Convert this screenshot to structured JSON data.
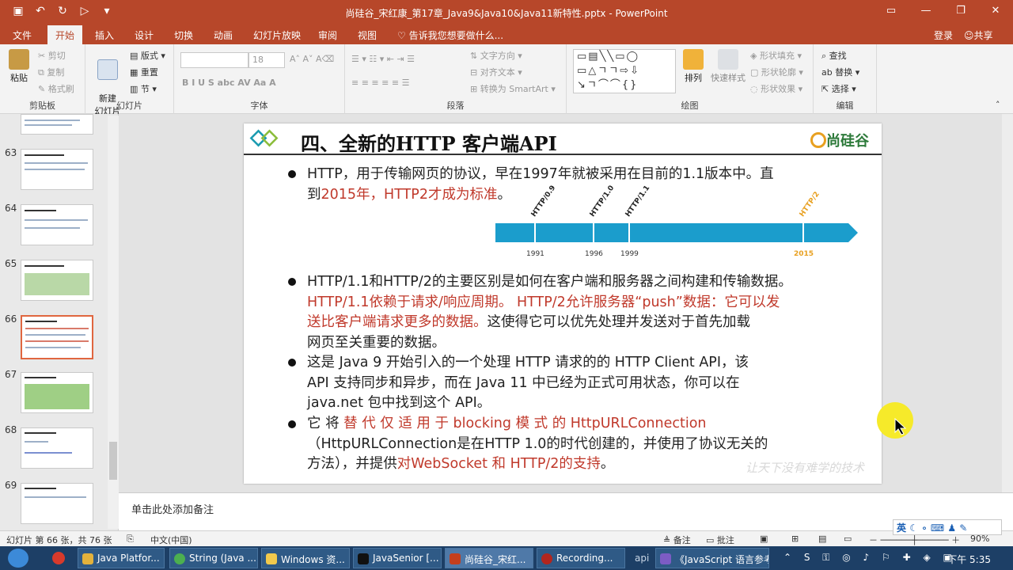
{
  "window": {
    "title": "尚硅谷_宋红康_第17章_Java9&Java10&Java11新特性.pptx - PowerPoint"
  },
  "ribbon_tabs": [
    "文件",
    "开始",
    "插入",
    "设计",
    "切换",
    "动画",
    "幻灯片放映",
    "审阅",
    "视图",
    "告诉我您想要做什么..."
  ],
  "account": {
    "login": "登录",
    "share": "共享"
  },
  "ribbon": {
    "clipboard": {
      "paste": "粘贴",
      "cut": "剪切",
      "copy": "复制",
      "format_painter": "格式刷",
      "label": "剪贴板"
    },
    "slides": {
      "new_slide": "新建\n幻灯片",
      "layout": "版式",
      "reset": "重置",
      "section": "节",
      "label": "幻灯片"
    },
    "font": {
      "size": "18",
      "label": "字体"
    },
    "paragraph": {
      "text_direction": "文字方向",
      "align_text": "对齐文本",
      "smartart": "转换为 SmartArt",
      "label": "段落"
    },
    "drawing": {
      "arrange": "排列",
      "quick_styles": "快速样式",
      "shape_fill": "形状填充",
      "shape_outline": "形状轮廓",
      "shape_effects": "形状效果",
      "label": "绘图"
    },
    "editing": {
      "find": "查找",
      "replace": "替换",
      "select": "选择",
      "label": "编辑"
    }
  },
  "thumbnails": [
    {
      "num": "63"
    },
    {
      "num": "64"
    },
    {
      "num": "65"
    },
    {
      "num": "66"
    },
    {
      "num": "67"
    },
    {
      "num": "68"
    },
    {
      "num": "69"
    }
  ],
  "slide": {
    "title": "四、全新的HTTP 客户端API",
    "logo": "尚硅谷",
    "b1_line1": "HTTP，用于传输网页的协议，早在1997年就被采用在目前的1.1版本中。直",
    "b1_line2a": "到",
    "b1_line2b": "2015年，HTTP2才成为标准",
    "b1_line2c": "。",
    "timeline": {
      "versions": [
        "HTTP/0.9",
        "HTTP/1.0",
        "HTTP/1.1",
        "HTTP/2"
      ],
      "years": [
        "1991",
        "1996",
        "1999",
        "2015"
      ]
    },
    "b2_line1": "HTTP/1.1和HTTP/2的主要区别是如何在客户端和服务器之间构建和传输数据。",
    "b2_line2": "HTTP/1.1依赖于请求/响应周期。 HTTP/2允许服务器“push”数据：它可以发",
    "b2_line3a": "送比客户端请求更多的数据。",
    "b2_line3b": "这使得它可以优先处理并发送对于首先加载",
    "b2_line4": "网页至关重要的数据。",
    "b3_line1": "这是 Java 9 开始引入的一个处理 HTTP 请求的的 HTTP Client API，该",
    "b3_line2": "API 支持同步和异步，而在 Java 11 中已经为正式可用状态，你可以在",
    "b3_line3": "java.net 包中找到这个 API。",
    "b4_line1a": "它 将 ",
    "b4_line1b": "替 代 仅 适 用 于 blocking 模 式 的 HttpURLConnection",
    "b4_line2": "（HttpURLConnection是在HTTP 1.0的时代创建的，并使用了协议无关的",
    "b4_line3a": "方法），并提供",
    "b4_line3b": "对WebSocket 和 HTTP/2的支持",
    "b4_line3c": "。",
    "watermark": "让天下没有难学的技术"
  },
  "notes": {
    "placeholder": "单击此处添加备注"
  },
  "status": {
    "slide_count": "幻灯片 第 66 张，共 76 张",
    "language": "中文(中国)",
    "notes": "备注",
    "comments": "批注",
    "zoom": "90%"
  },
  "taskbar": [
    {
      "label": "Java Platfor..."
    },
    {
      "label": "String (Java ..."
    },
    {
      "label": "Windows 资..."
    },
    {
      "label": "JavaSenior [..."
    },
    {
      "label": "尚硅谷_宋红..."
    },
    {
      "label": "Recording..."
    },
    {
      "label": "api"
    },
    {
      "label": "《JavaScript 语言参考..."
    }
  ],
  "clock": "下午 5:35",
  "ime": "英"
}
